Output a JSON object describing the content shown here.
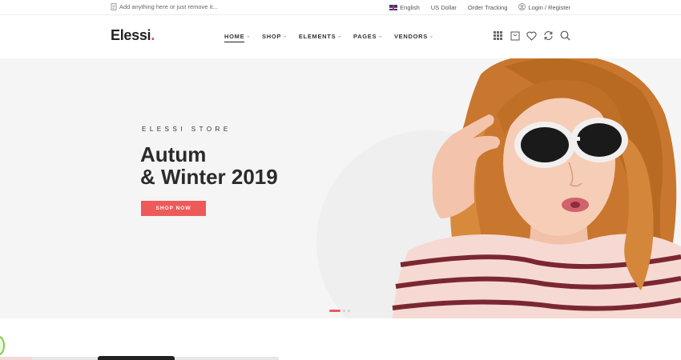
{
  "topbar": {
    "announcement": "Add anything here or just remove it...",
    "language": "English",
    "currency": "US Dollar",
    "order_tracking": "Order Tracking",
    "login": "Login / Register"
  },
  "header": {
    "logo_text": "Elessi",
    "logo_dot": ".",
    "nav": [
      {
        "label": "HOME",
        "active": true
      },
      {
        "label": "SHOP"
      },
      {
        "label": "ELEMENTS"
      },
      {
        "label": "PAGES"
      },
      {
        "label": "VENDORS"
      }
    ],
    "icons": [
      "grid-icon",
      "cart-icon",
      "heart-icon",
      "compare-icon",
      "search-icon"
    ]
  },
  "hero": {
    "eyebrow": "ELESSI STORE",
    "headline_line1": "Autum",
    "headline_line2": "& Winter 2019",
    "cta": "SHOP NOW",
    "slides": 3,
    "active_slide": 1
  },
  "colors": {
    "accent": "#ee5a5a",
    "text_dark": "#2b2b2b",
    "hero_bg": "#f5f5f5"
  }
}
